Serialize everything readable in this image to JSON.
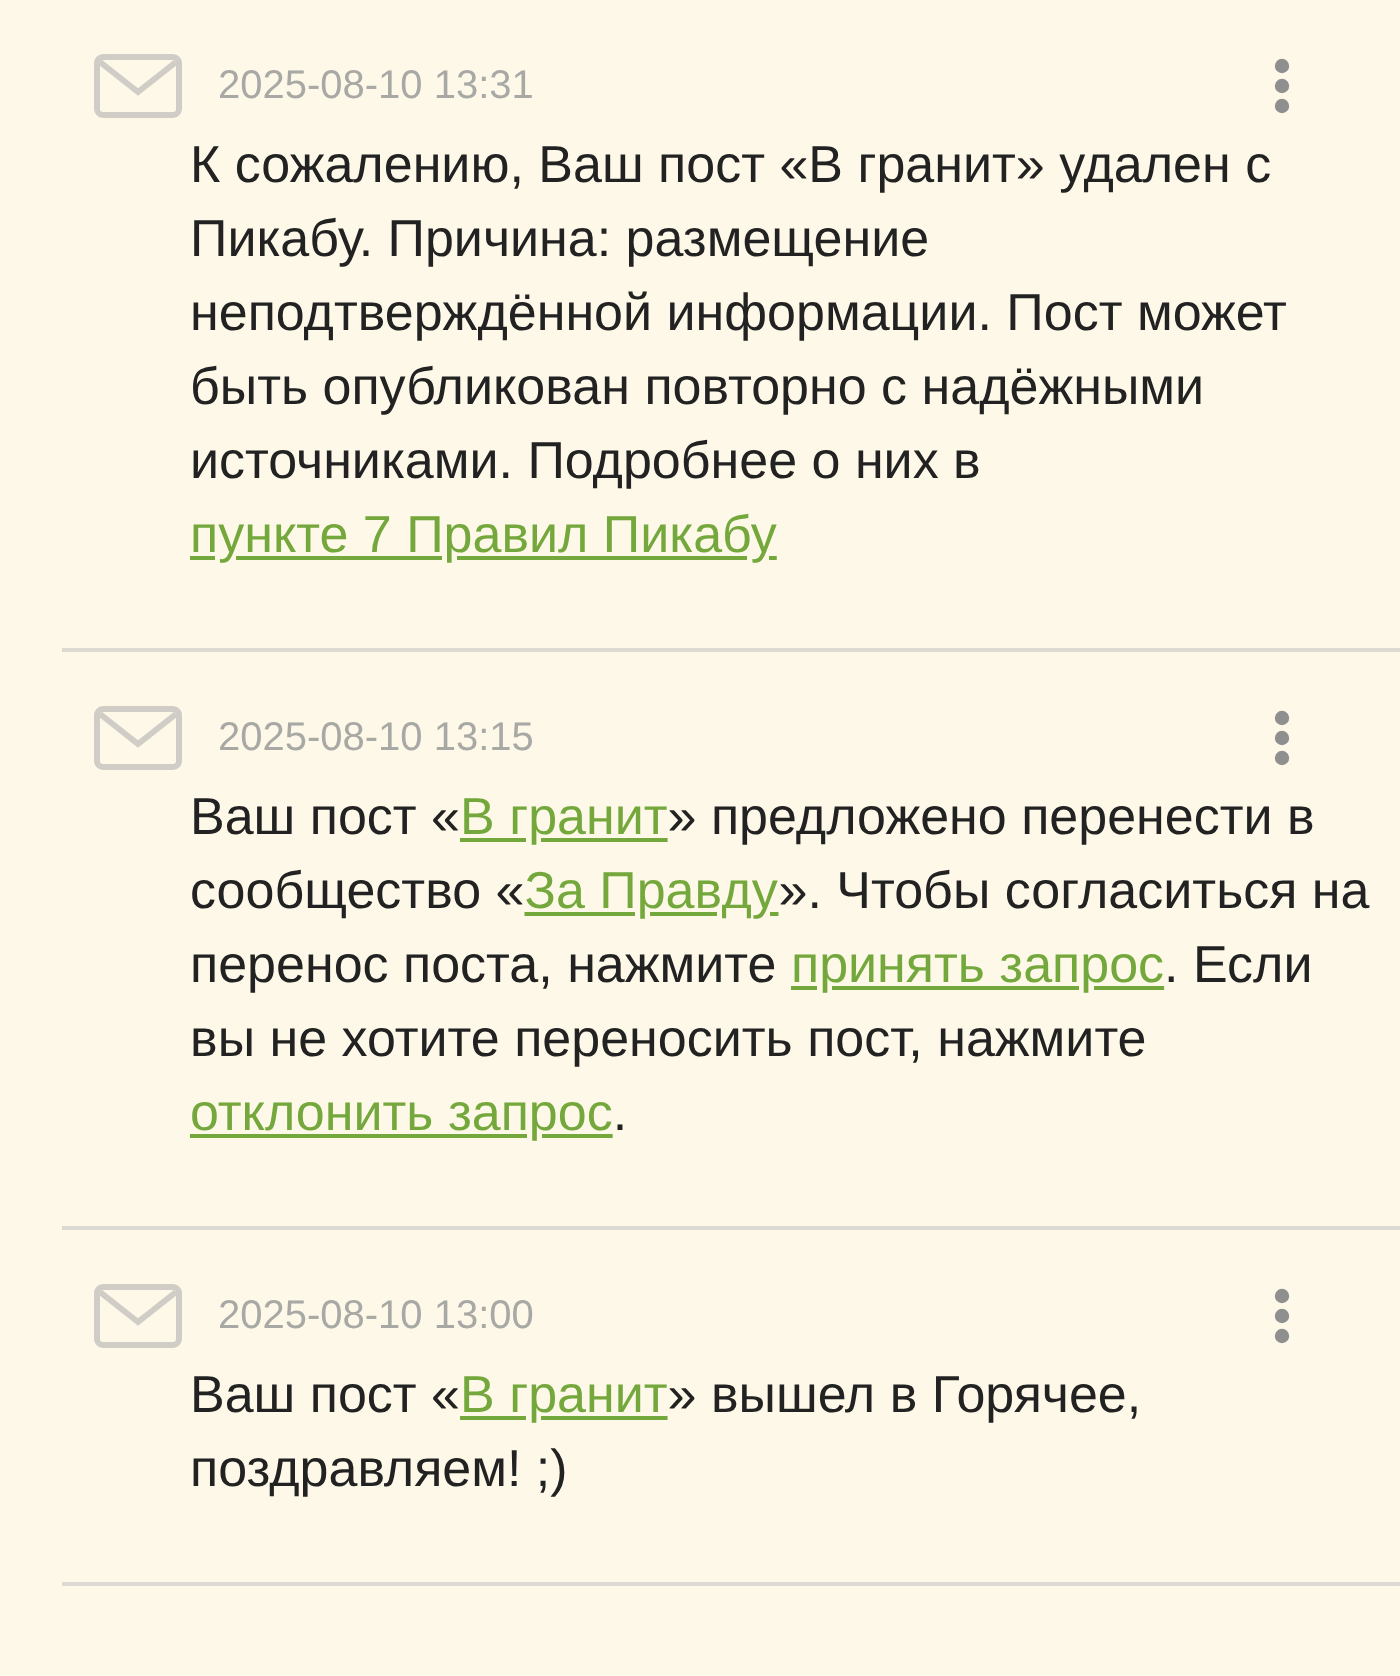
{
  "notifications": [
    {
      "time": "2025-08-10 13:31",
      "parts": [
        {
          "kind": "text",
          "text": "К сожалению, Ваш пост «В гранит» удален с Пикабу. Причина: размещение неподтверждённой информации. Пост может быть опубликован повторно с надёжными источниками. Подробнее о них в "
        },
        {
          "kind": "link",
          "text": "пункте 7 Правил Пикабу"
        }
      ]
    },
    {
      "time": "2025-08-10 13:15",
      "parts": [
        {
          "kind": "text",
          "text": "Ваш пост «"
        },
        {
          "kind": "link",
          "text": "В гранит"
        },
        {
          "kind": "text",
          "text": "» предложено перенести в сообщество «"
        },
        {
          "kind": "link",
          "text": "За Правду"
        },
        {
          "kind": "text",
          "text": "». Чтобы согласиться на перенос поста, нажмите "
        },
        {
          "kind": "link",
          "text": "принять запрос"
        },
        {
          "kind": "text",
          "text": ". Если вы не хотите переносить пост, нажмите "
        },
        {
          "kind": "link",
          "text": "отклонить запрос"
        },
        {
          "kind": "text",
          "text": "."
        }
      ]
    },
    {
      "time": "2025-08-10 13:00",
      "parts": [
        {
          "kind": "text",
          "text": "Ваш пост «"
        },
        {
          "kind": "link",
          "text": "В гранит"
        },
        {
          "kind": "text",
          "text": "» вышел в Горячее, поздравляем! ;)"
        }
      ]
    }
  ]
}
